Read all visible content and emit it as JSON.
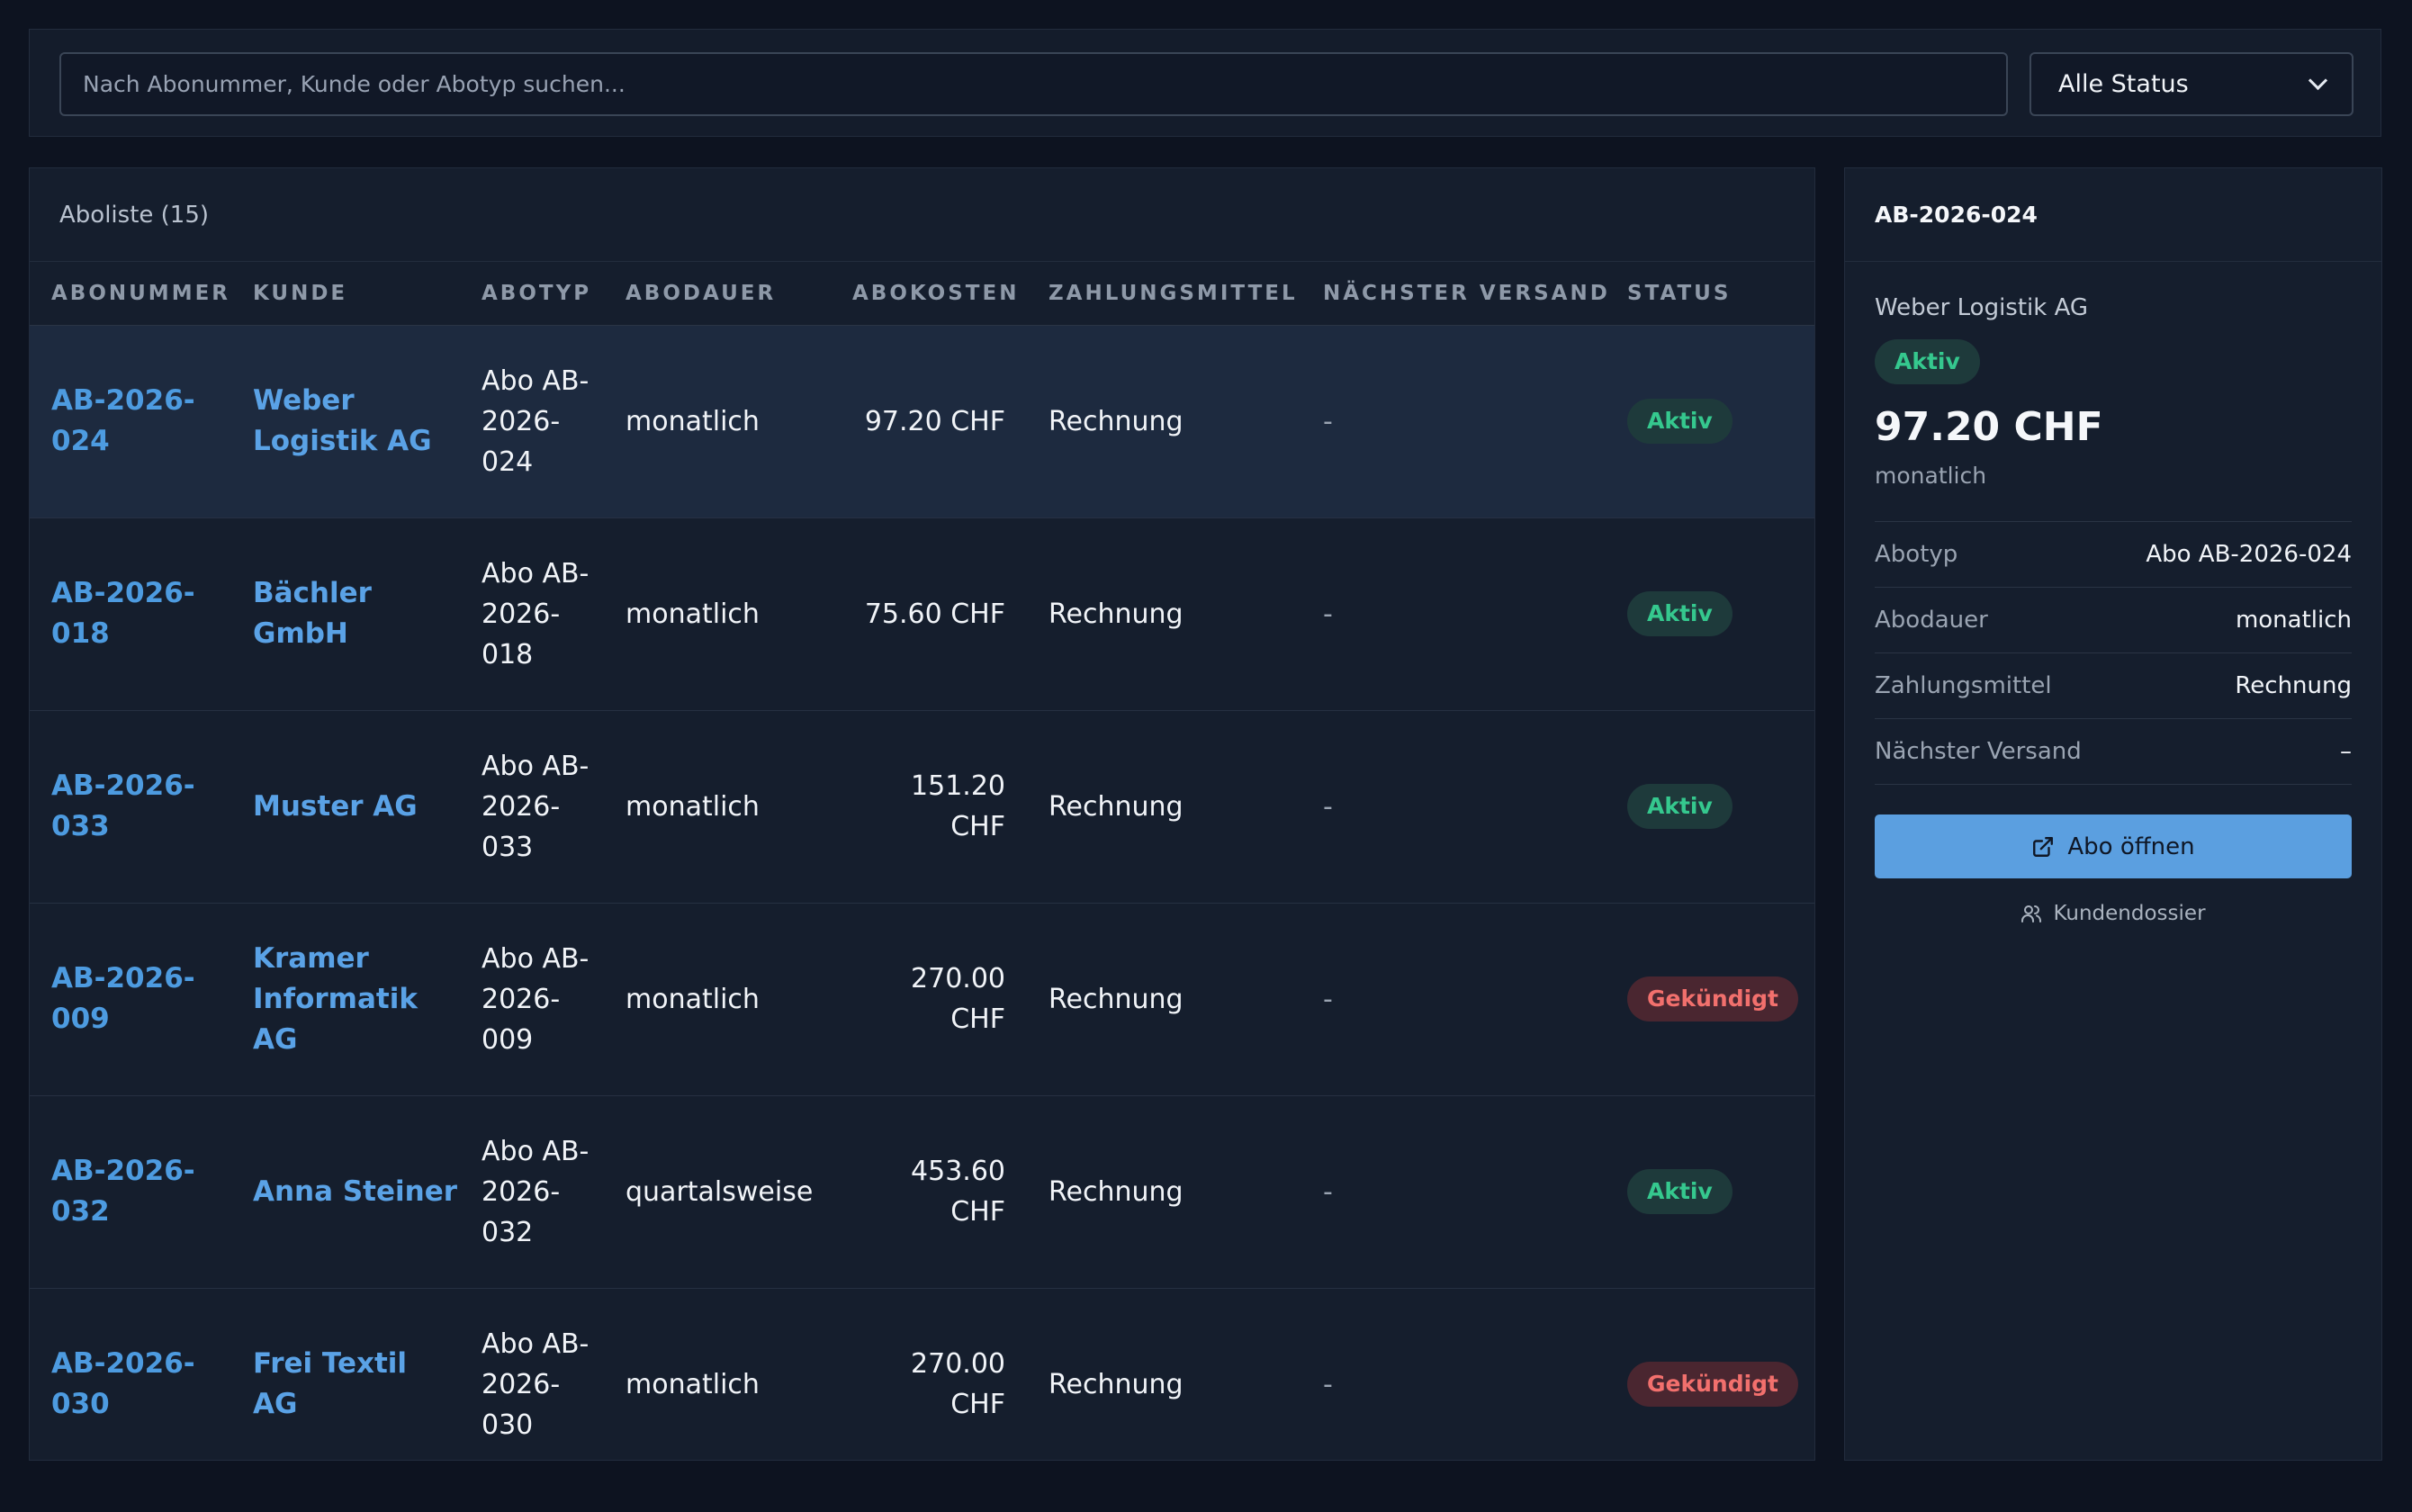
{
  "search": {
    "placeholder": "Nach Abonummer, Kunde oder Abotyp suchen..."
  },
  "status_filter": {
    "selected": "Alle Status"
  },
  "list": {
    "title": "Aboliste (15)",
    "columns": [
      "ABONUMMER",
      "KUNDE",
      "ABOTYP",
      "ABODAUER",
      "ABOKOSTEN",
      "ZAHLUNGSMITTEL",
      "NÄCHSTER VERSAND",
      "STATUS"
    ],
    "rows": [
      {
        "abonummer": "AB-2026-024",
        "kunde": "Weber Logistik AG",
        "abotyp": "Abo AB-2026-024",
        "abodauer": "monatlich",
        "abokosten": "97.20 CHF",
        "zahlungsmittel": "Rechnung",
        "versand": "-",
        "status": "Aktiv"
      },
      {
        "abonummer": "AB-2026-018",
        "kunde": "Bächler GmbH",
        "abotyp": "Abo AB-2026-018",
        "abodauer": "monatlich",
        "abokosten": "75.60 CHF",
        "zahlungsmittel": "Rechnung",
        "versand": "-",
        "status": "Aktiv"
      },
      {
        "abonummer": "AB-2026-033",
        "kunde": "Muster AG",
        "abotyp": "Abo AB-2026-033",
        "abodauer": "monatlich",
        "abokosten": "151.20 CHF",
        "zahlungsmittel": "Rechnung",
        "versand": "-",
        "status": "Aktiv"
      },
      {
        "abonummer": "AB-2026-009",
        "kunde": "Kramer Informatik AG",
        "abotyp": "Abo AB-2026-009",
        "abodauer": "monatlich",
        "abokosten": "270.00 CHF",
        "zahlungsmittel": "Rechnung",
        "versand": "-",
        "status": "Gekündigt"
      },
      {
        "abonummer": "AB-2026-032",
        "kunde": "Anna Steiner",
        "abotyp": "Abo AB-2026-032",
        "abodauer": "quartalsweise",
        "abokosten": "453.60 CHF",
        "zahlungsmittel": "Rechnung",
        "versand": "-",
        "status": "Aktiv"
      },
      {
        "abonummer": "AB-2026-030",
        "kunde": "Frei Textil AG",
        "abotyp": "Abo AB-2026-030",
        "abodauer": "monatlich",
        "abokosten": "270.00 CHF",
        "zahlungsmittel": "Rechnung",
        "versand": "-",
        "status": "Gekündigt"
      }
    ]
  },
  "detail": {
    "abonummer": "AB-2026-024",
    "kunde": "Weber Logistik AG",
    "status": "Aktiv",
    "preis": "97.20 CHF",
    "intervall": "monatlich",
    "fields": [
      {
        "label": "Abotyp",
        "value": "Abo AB-2026-024"
      },
      {
        "label": "Abodauer",
        "value": "monatlich"
      },
      {
        "label": "Zahlungsmittel",
        "value": "Rechnung"
      },
      {
        "label": "Nächster Versand",
        "value": "–"
      }
    ],
    "open_button": "Abo öffnen",
    "dossier_link": "Kundendossier"
  },
  "icons": {
    "open": "external-link-icon",
    "dossier": "users-icon",
    "select": "chevron-down-icon"
  },
  "colors": {
    "accent": "#5b9fe0",
    "aktiv": "#35c88e",
    "gekuendigt": "#f2706d",
    "background": "#0d1320"
  }
}
